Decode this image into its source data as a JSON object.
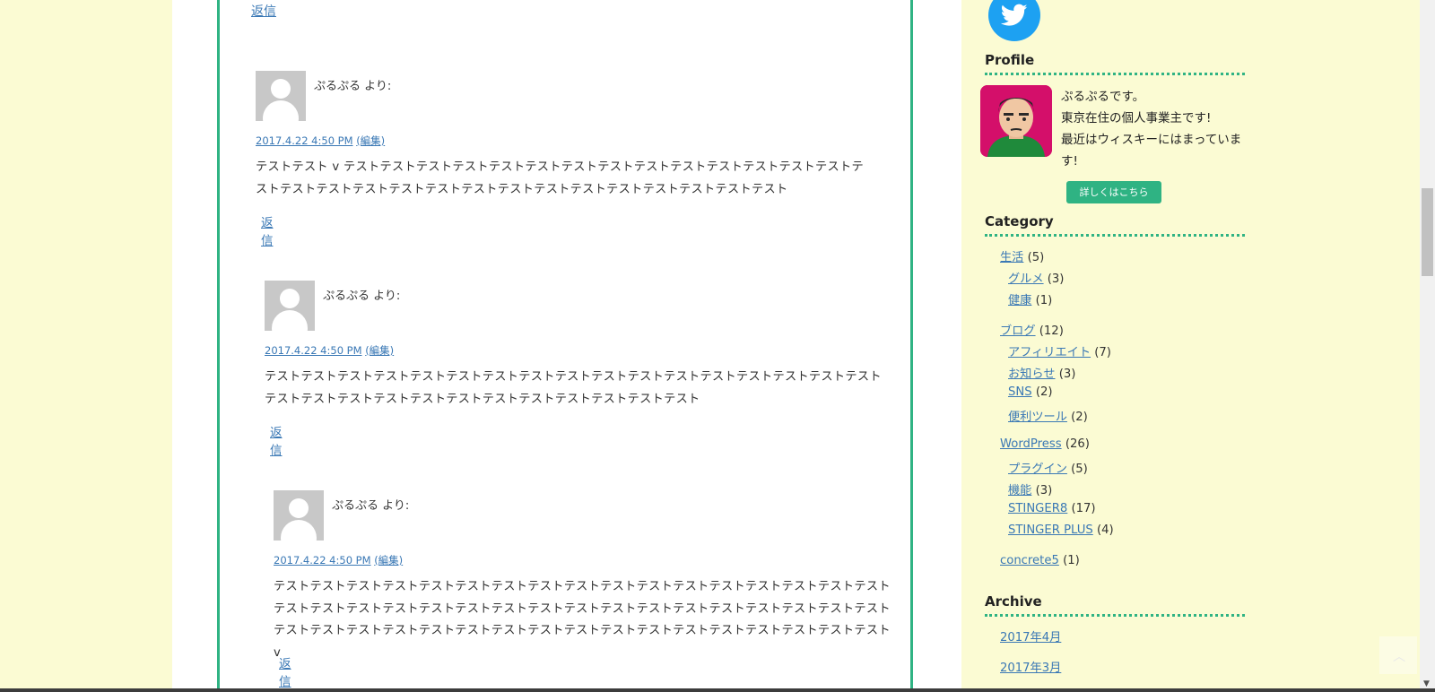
{
  "comments": {
    "top_reply": "返信",
    "items": [
      {
        "author": "ぷるぷる より:",
        "date": "2017.4.22 4:50 PM",
        "edit": "(編集)",
        "text": "テストテスト v テストテストテストテストテストテストテストテストテストテストテストテストテストテストテストテストテストテストテストテストテストテストテストテストテストテストテストテストテスト",
        "reply": "返信"
      },
      {
        "author": "ぷるぷる より:",
        "date": "2017.4.22 4:50 PM",
        "edit": "(編集)",
        "text": "テストテストテストテストテストテストテストテストテストテストテストテストテストテストテストテストテストテストテストテストテストテストテストテストテストテストテストテストテスト",
        "reply": "返信"
      },
      {
        "author": "ぷるぷる より:",
        "date": "2017.4.22 4:50 PM",
        "edit": "(編集)",
        "text": "テストテストテストテストテストテストテストテストテストテストテストテストテストテストテストテストテストテストテストテストテストテストテストテストテストテストテストテストテストテストテストテストテストテストテストテストテストテストテストテストテストテストテストテストテストテストテストテストテストテストテスト v",
        "reply": "返信"
      }
    ]
  },
  "sidebar": {
    "twitter_icon": "twitter-icon",
    "profile_title": "Profile",
    "profile_lines": [
      "ぷるぷるです。",
      "東京在住の個人事業主です!",
      "最近はウィスキーにはまっています!"
    ],
    "detail_button": "詳しくはこちら",
    "category_title": "Category",
    "categories": [
      {
        "name": "生活",
        "count": "(5)"
      },
      {
        "name": "グルメ",
        "count": "(3)"
      },
      {
        "name": "健康",
        "count": "(1)"
      },
      {
        "name": "ブログ",
        "count": "(12)"
      },
      {
        "name": "アフィリエイト",
        "count": "(7)"
      },
      {
        "name": "お知らせ",
        "count": "(3)"
      },
      {
        "name": "SNS",
        "count": "(2)"
      },
      {
        "name": "便利ツール",
        "count": "(2)"
      },
      {
        "name": "WordPress",
        "count": "(26)"
      },
      {
        "name": "プラグイン",
        "count": "(5)"
      },
      {
        "name": "機能",
        "count": "(3)"
      },
      {
        "name": "STINGER8",
        "count": "(17)"
      },
      {
        "name": "STINGER PLUS",
        "count": "(4)"
      },
      {
        "name": "concrete5",
        "count": "(1)"
      }
    ],
    "archive_title": "Archive",
    "archives": [
      "2017年4月",
      "2017年3月"
    ]
  },
  "colors": {
    "accent": "#2fb383",
    "background": "#fbfbd3",
    "link": "#3a78b5"
  }
}
